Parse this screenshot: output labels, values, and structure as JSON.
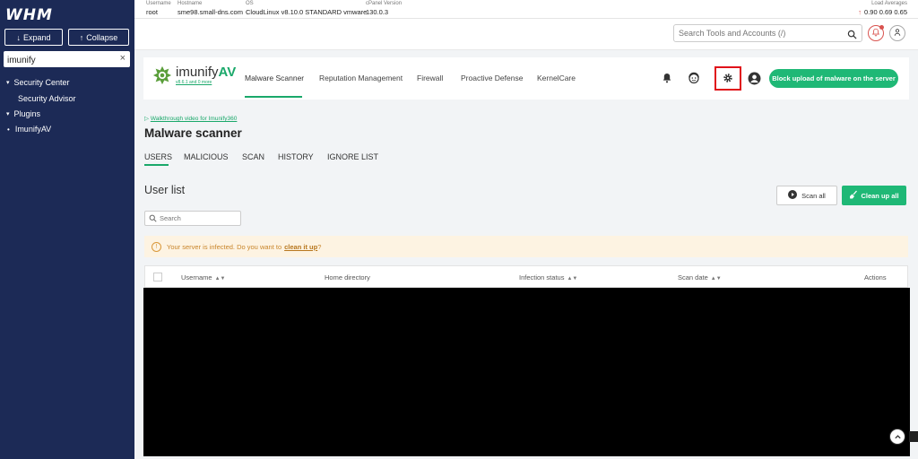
{
  "sidebar": {
    "logo": "WHM",
    "expand_label": "Expand",
    "collapse_label": "Collapse",
    "search_value": "imunify",
    "clear_symbol": "×",
    "items": [
      {
        "label": "Security Center",
        "type": "group"
      },
      {
        "label": "Security Advisor",
        "type": "link"
      },
      {
        "label": "Plugins",
        "type": "group"
      },
      {
        "label": "ImunifyAV",
        "type": "link"
      }
    ]
  },
  "topbar": {
    "username_label": "Username",
    "username": "root",
    "hostname_label": "Hostname",
    "hostname": "sme98.small-dns.com",
    "os_label": "OS",
    "os": "CloudLinux v8.10.0 STANDARD vmware",
    "cpanel_label": "cPanel Version",
    "cpanel": "130.0.3",
    "load_label": "Load Averages",
    "load": "0.90  0.69  0.65"
  },
  "header": {
    "search_placeholder": "Search Tools and Accounts (/)"
  },
  "imunify": {
    "brand_prefix": "imunify",
    "brand_suffix": "AV",
    "version": "v8.6.1 and 0 more",
    "tabs": [
      {
        "label": "Malware Scanner",
        "active": true
      },
      {
        "label": "Reputation Management",
        "active": false
      },
      {
        "label": "Firewall",
        "active": false
      },
      {
        "label": "Proactive Defense",
        "active": false
      },
      {
        "label": "KernelCare",
        "active": false
      }
    ],
    "block_upload_label": "Block upload of malware on the server"
  },
  "scanner": {
    "walkthrough": "Walkthrough video for Imunify360",
    "title": "Malware scanner",
    "subtabs": [
      "USERS",
      "MALICIOUS",
      "SCAN",
      "HISTORY",
      "IGNORE LIST"
    ],
    "active_subtab": "USERS",
    "section_title": "User list",
    "scan_all_label": "Scan all",
    "clean_up_all_label": "Clean up all",
    "search_placeholder": "Search",
    "warning_text": "Your server is infected. Do you want to",
    "warning_link": "clean it up",
    "warning_end": "?",
    "columns": [
      "Username",
      "Home directory",
      "Infection status",
      "Scan date",
      "Actions"
    ]
  },
  "colors": {
    "sidebar_bg": "#1c2a56",
    "accent_green": "#1fb876",
    "highlight_red": "#e0121a",
    "warning_bg": "#fdf3e2"
  }
}
